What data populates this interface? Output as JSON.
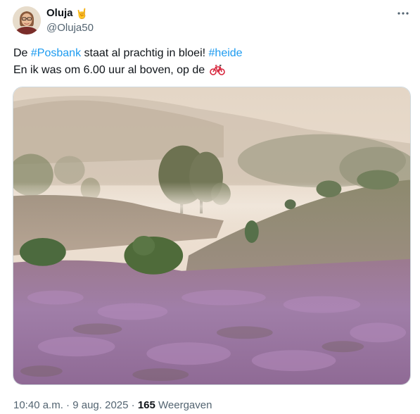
{
  "author": {
    "display_name": "Oluja",
    "name_emoji": "🤘",
    "handle": "@Oluja50"
  },
  "tweet": {
    "line1": [
      {
        "text": "De ",
        "type": "text"
      },
      {
        "text": "#Posbank",
        "type": "hashtag"
      },
      {
        "text": " staat al prachtig in bloei! ",
        "type": "text"
      },
      {
        "text": "#heide",
        "type": "hashtag"
      }
    ],
    "line2_text": "En ik was om 6.00 uur al boven, op de ",
    "line2_emoji": "bicycle-icon"
  },
  "media": {
    "icon": "photo-heathland-misty-morning",
    "colors": {
      "sky": "#e9ddd0",
      "heather": "#a27aa6",
      "tree": "#4f6b3a"
    }
  },
  "meta": {
    "time": "10:40 a.m.",
    "sep1": " · ",
    "date": "9 aug. 2025",
    "sep2": " · ",
    "views_count": "165",
    "views_label": " Weergaven"
  },
  "colors": {
    "link": "#1d9bf0",
    "muted": "#536471",
    "text": "#0f1419",
    "border": "#cfd9de"
  }
}
